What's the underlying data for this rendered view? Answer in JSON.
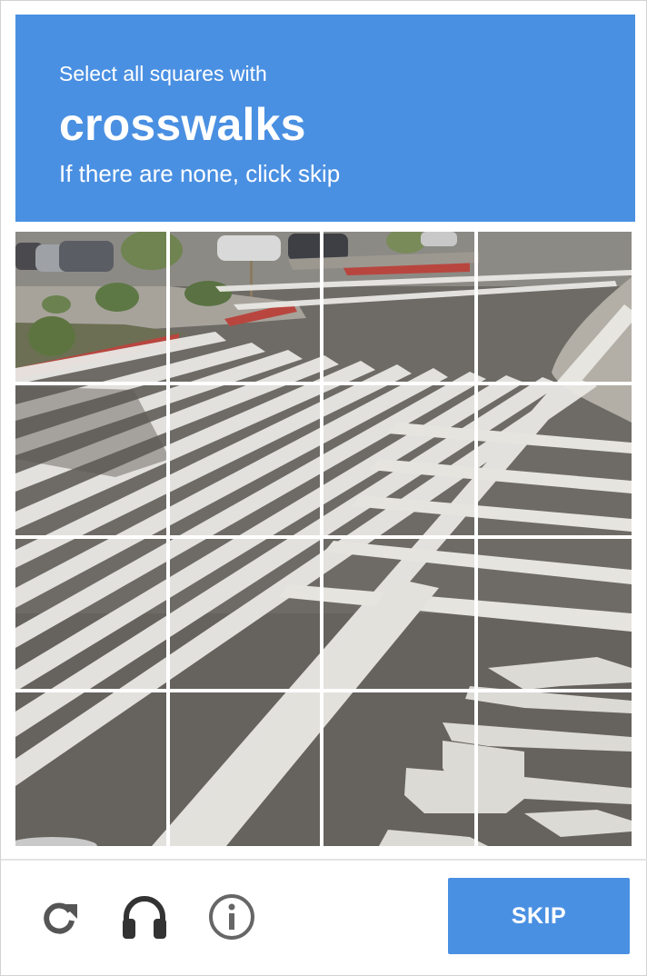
{
  "header": {
    "instruction": "Select all squares with",
    "target": "crosswalks",
    "hint": "If there are none, click skip"
  },
  "grid": {
    "rows": 4,
    "cols": 4
  },
  "footer": {
    "reload_icon": "reload-icon",
    "audio_icon": "headphones-icon",
    "info_icon": "info-icon",
    "skip_label": "SKIP"
  },
  "colors": {
    "accent": "#4a90e2",
    "button_text": "#ffffff",
    "icon": "#555555"
  }
}
